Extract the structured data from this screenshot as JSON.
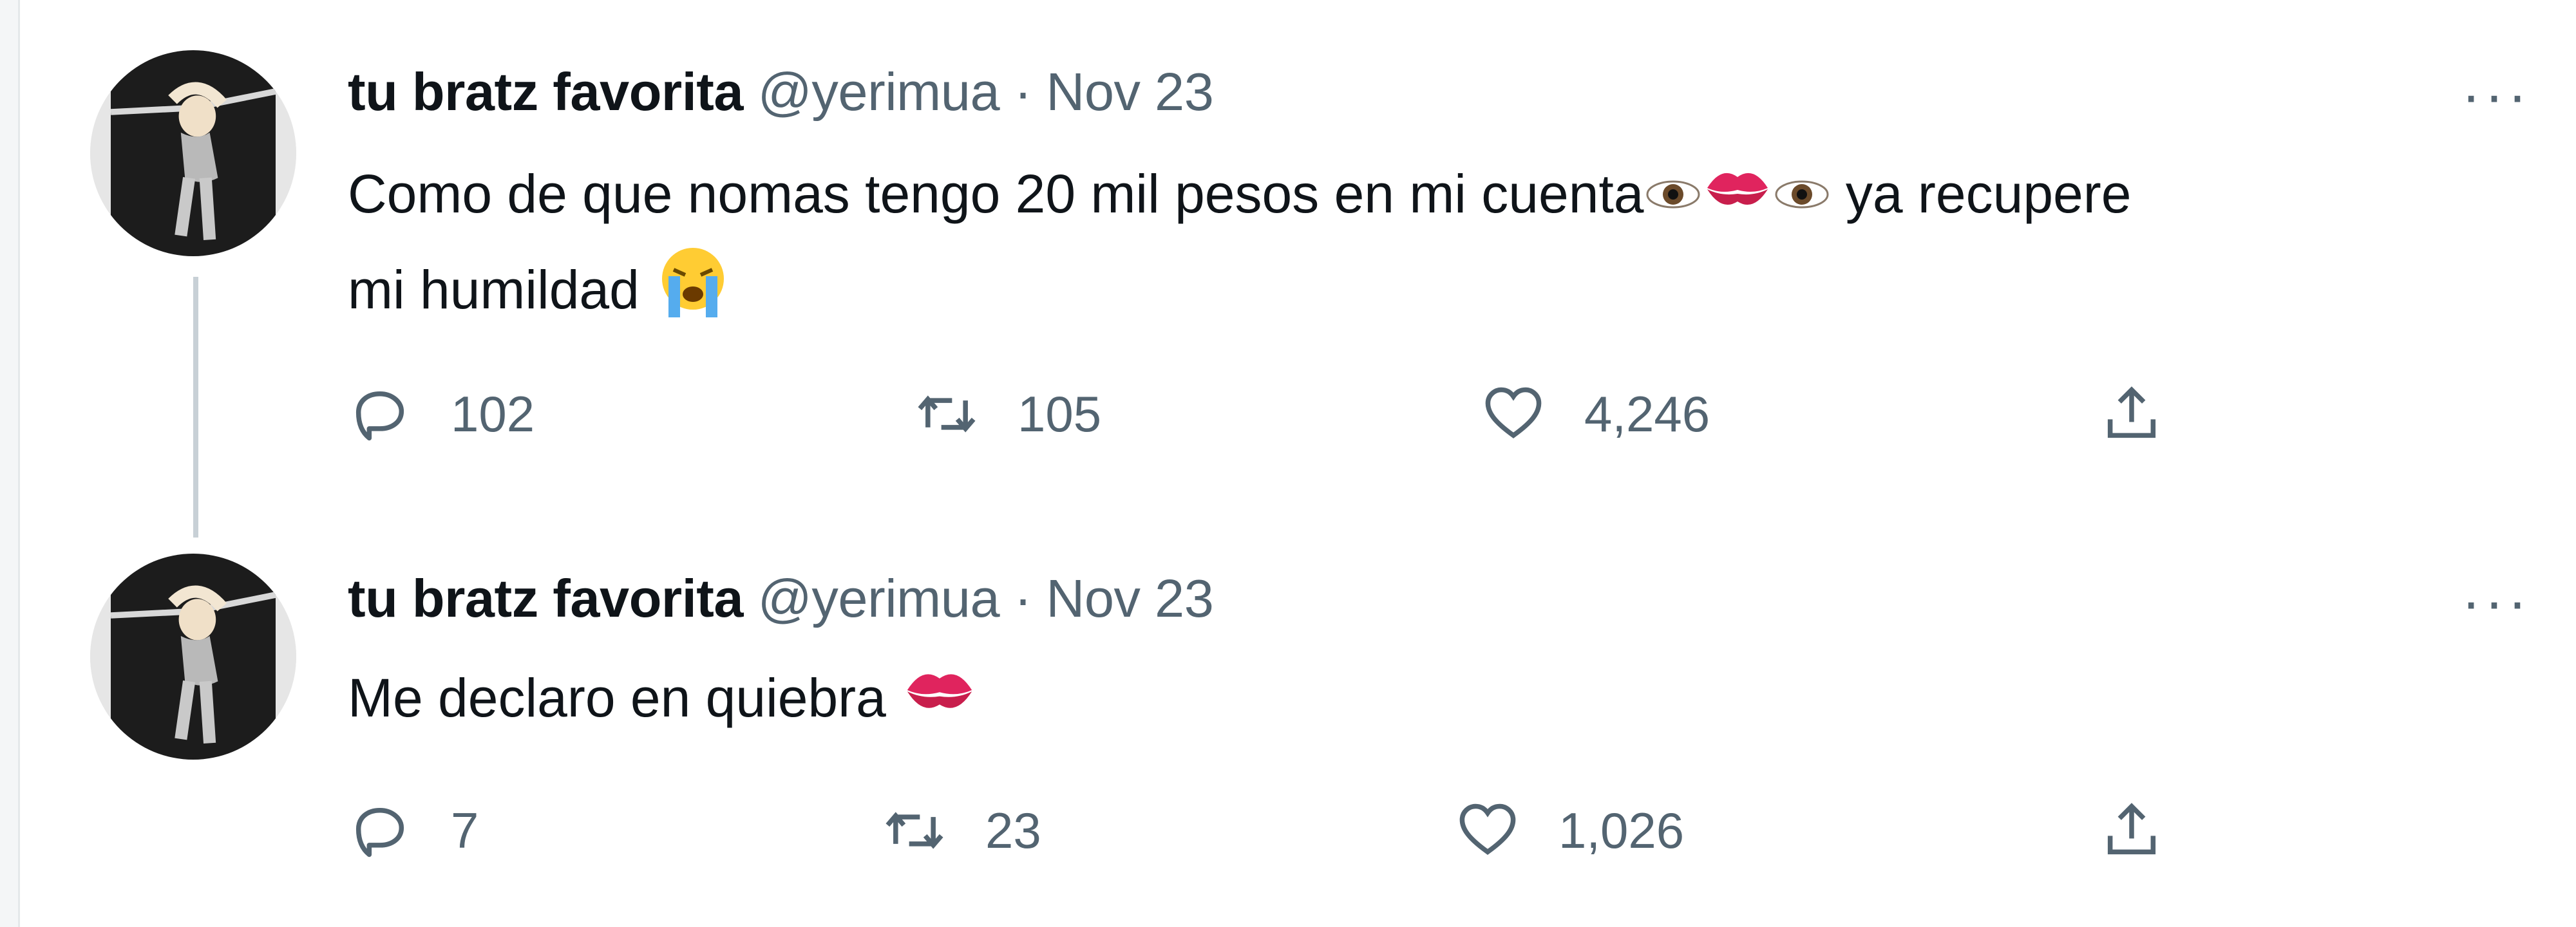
{
  "tweets": [
    {
      "author_name": "tu bratz favorita",
      "handle": "@yerimua",
      "separator": "·",
      "date": "Nov 23",
      "text_line1": "Como de que nomas tengo 20 mil pesos en mi cuenta",
      "text_after_emojis": "ya recupere",
      "text_line2": "mi humildad",
      "emoji_names": [
        "eye-emoji",
        "kiss-mark-emoji",
        "eye-emoji",
        "loudly-crying-face-emoji"
      ],
      "replies": "102",
      "retweets": "105",
      "likes": "4,246",
      "more_label": "···"
    },
    {
      "author_name": "tu bratz favorita",
      "handle": "@yerimua",
      "separator": "·",
      "date": "Nov 23",
      "text_line1": "Me declaro en quiebra",
      "emoji_names": [
        "kiss-mark-emoji"
      ],
      "replies": "7",
      "retweets": "23",
      "likes": "1,026",
      "more_label": "···"
    }
  ],
  "icons": {
    "reply": "reply-icon",
    "retweet": "retweet-icon",
    "like": "like-icon",
    "share": "share-icon"
  },
  "colors": {
    "text": "#0f1419",
    "secondary": "#536471",
    "thread_line": "#c8d0d6",
    "kiss_red": "#e0245e"
  }
}
